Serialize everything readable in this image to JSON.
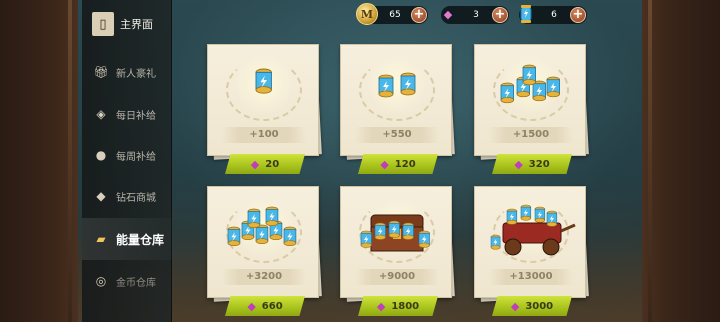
{
  "sidebar": {
    "items": [
      {
        "label": "主界面",
        "icon": "door-icon"
      },
      {
        "label": "新人豪礼",
        "icon": "gift-icon"
      },
      {
        "label": "每日补给",
        "icon": "supply-box-icon"
      },
      {
        "label": "每周补给",
        "icon": "supply-bag-icon"
      },
      {
        "label": "钻石商城",
        "icon": "diamond-shop-icon"
      },
      {
        "label": "能量仓库",
        "icon": "energy-warehouse-icon"
      },
      {
        "label": "金币仓库",
        "icon": "coin-warehouse-icon"
      }
    ],
    "active": "能量仓库"
  },
  "resources": {
    "coins": {
      "value": "65",
      "icon": "coin-icon",
      "glyph": "M"
    },
    "gems": {
      "value": "3",
      "icon": "gem-icon"
    },
    "energy": {
      "value": "6",
      "icon": "energy-canister-icon"
    }
  },
  "packs": [
    {
      "amount": "+100",
      "price": "20",
      "art": "single-canister"
    },
    {
      "amount": "+550",
      "price": "120",
      "art": "canister-pair"
    },
    {
      "amount": "+1500",
      "price": "320",
      "art": "canister-pile"
    },
    {
      "amount": "+3200",
      "price": "660",
      "art": "canister-bundle"
    },
    {
      "amount": "+9000",
      "price": "1800",
      "art": "treasure-chest"
    },
    {
      "amount": "+13000",
      "price": "3000",
      "art": "treasure-cart"
    }
  ],
  "colors": {
    "price_button": "#b5cf22",
    "gem": "#c03dbb",
    "card": "#f3ebd6",
    "canister": "#49b8e8",
    "gold": "#e6b33a"
  }
}
